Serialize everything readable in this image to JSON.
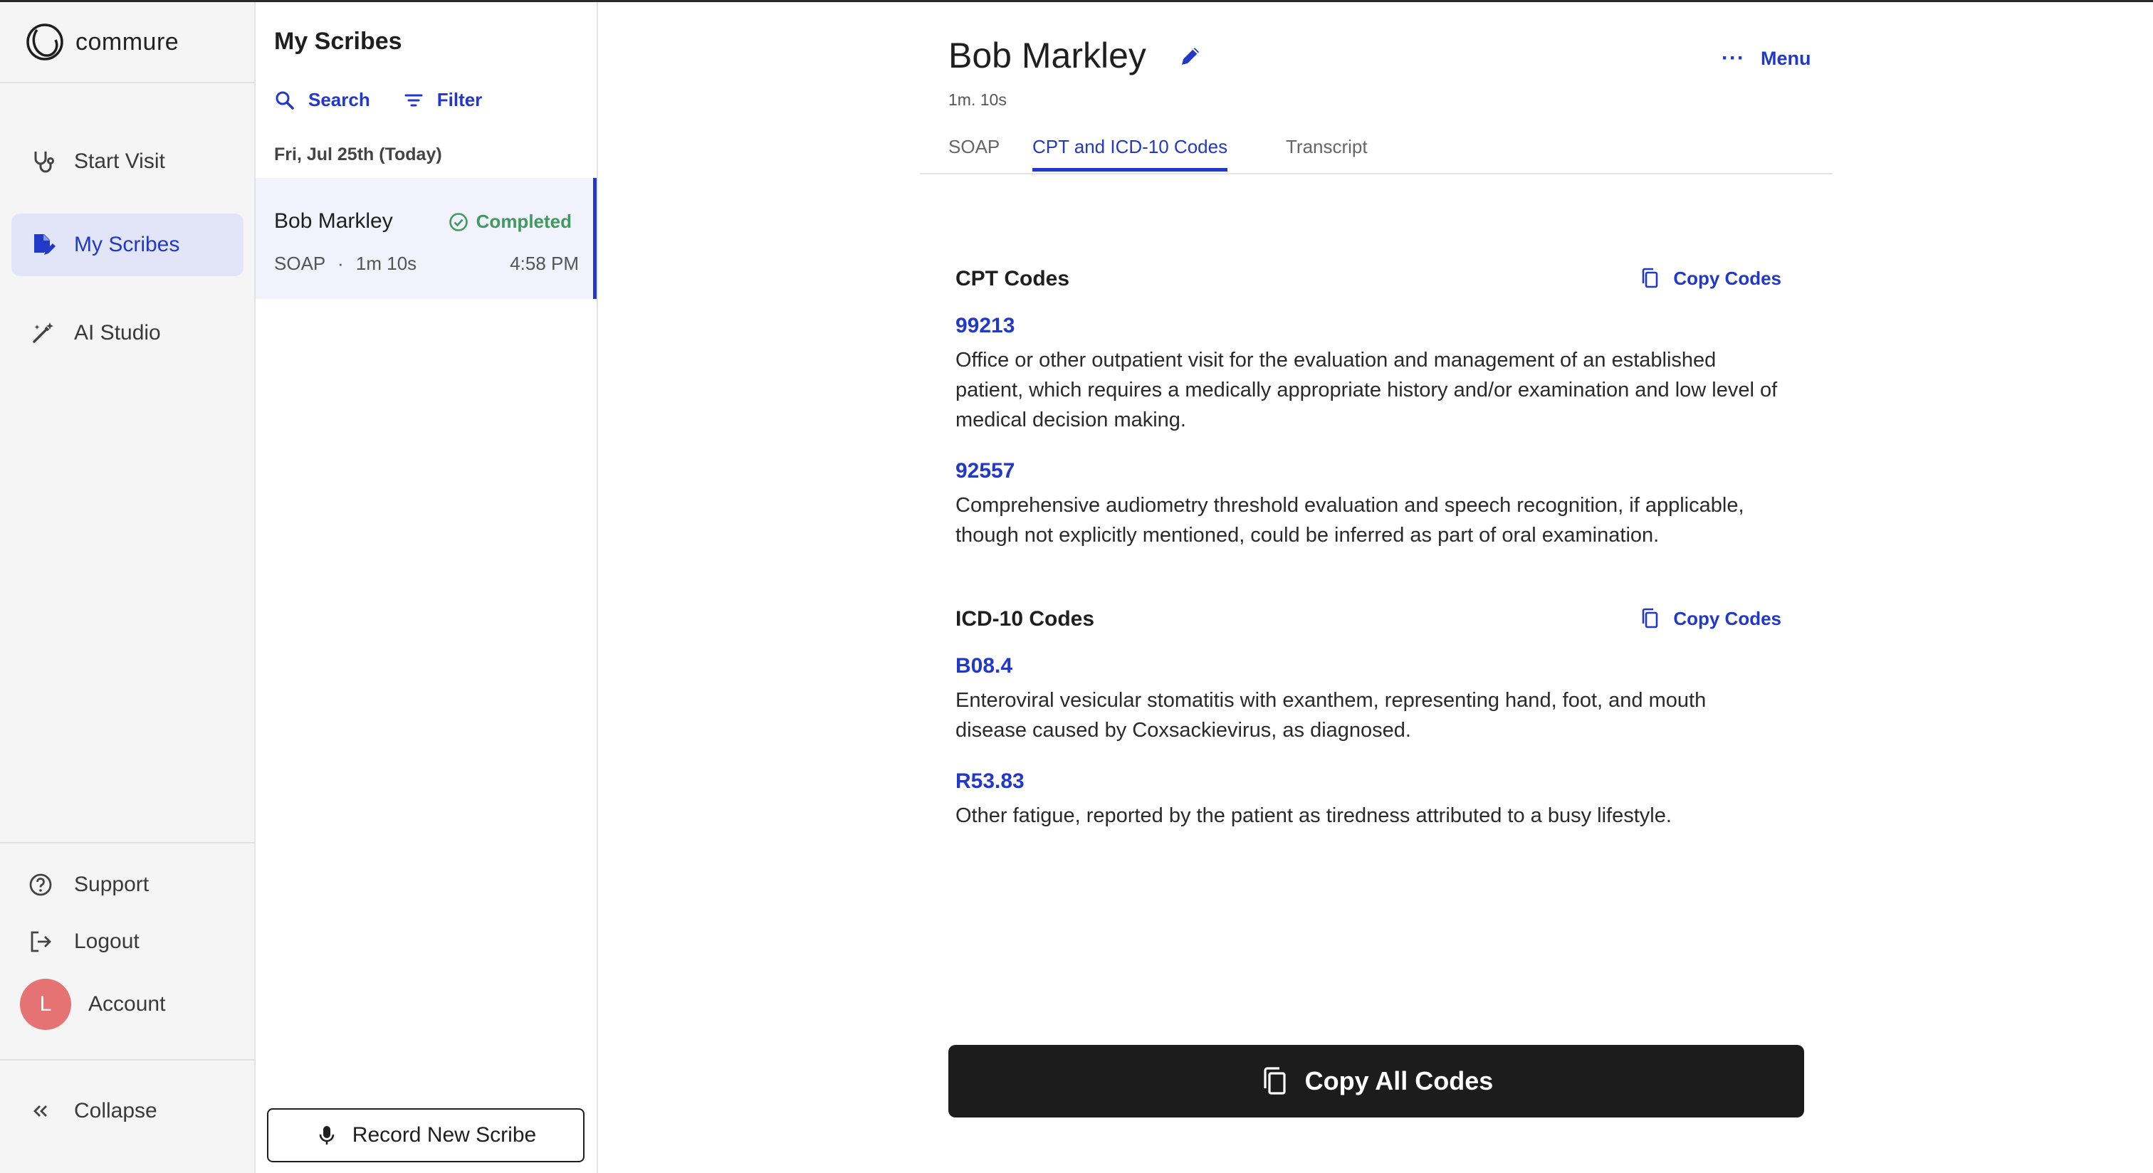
{
  "brand": {
    "name": "commure"
  },
  "nav": {
    "items": [
      {
        "label": "Start Visit",
        "icon": "stethoscope-icon"
      },
      {
        "label": "My Scribes",
        "icon": "document-edit-icon",
        "active": true
      },
      {
        "label": "AI Studio",
        "icon": "magic-wand-icon"
      }
    ],
    "support_label": "Support",
    "logout_label": "Logout",
    "account_label": "Account",
    "avatar_initial": "L",
    "collapse_label": "Collapse"
  },
  "scribes_panel": {
    "title": "My Scribes",
    "search_label": "Search",
    "filter_label": "Filter",
    "date_heading": "Fri, Jul 25th (Today)",
    "items": [
      {
        "name": "Bob Markley",
        "status": "Completed",
        "type": "SOAP",
        "separator": "·",
        "duration": "1m 10s",
        "time": "4:58 PM"
      }
    ],
    "record_button_label": "Record New Scribe"
  },
  "main": {
    "patient_name": "Bob Markley",
    "duration": "1m. 10s",
    "menu_label": "Menu",
    "menu_dots": "···",
    "tabs": [
      {
        "label": "SOAP"
      },
      {
        "label": "CPT and ICD-10 Codes",
        "active": true
      },
      {
        "label": "Transcript"
      }
    ],
    "cpt": {
      "title": "CPT Codes",
      "copy_label": "Copy Codes",
      "codes": [
        {
          "code": "99213",
          "description": "Office or other outpatient visit for the evaluation and management of an established patient, which requires a medically appropriate history and/or examination and low level of medical decision making."
        },
        {
          "code": "92557",
          "description": "Comprehensive audiometry threshold evaluation and speech recognition, if applicable, though not explicitly mentioned, could be inferred as part of oral examination."
        }
      ]
    },
    "icd": {
      "title": "ICD-10 Codes",
      "copy_label": "Copy Codes",
      "codes": [
        {
          "code": "B08.4",
          "description": "Enteroviral vesicular stomatitis with exanthem, representing hand, foot, and mouth disease caused by Coxsackievirus, as diagnosed."
        },
        {
          "code": "R53.83",
          "description": "Other fatigue, reported by the patient as tiredness attributed to a busy lifestyle."
        }
      ]
    },
    "copy_all_label": "Copy All Codes"
  },
  "colors": {
    "accent": "#2138c9",
    "completed": "#3f9a5e",
    "avatar": "#e57373",
    "primary_button": "#1c1c1c"
  }
}
